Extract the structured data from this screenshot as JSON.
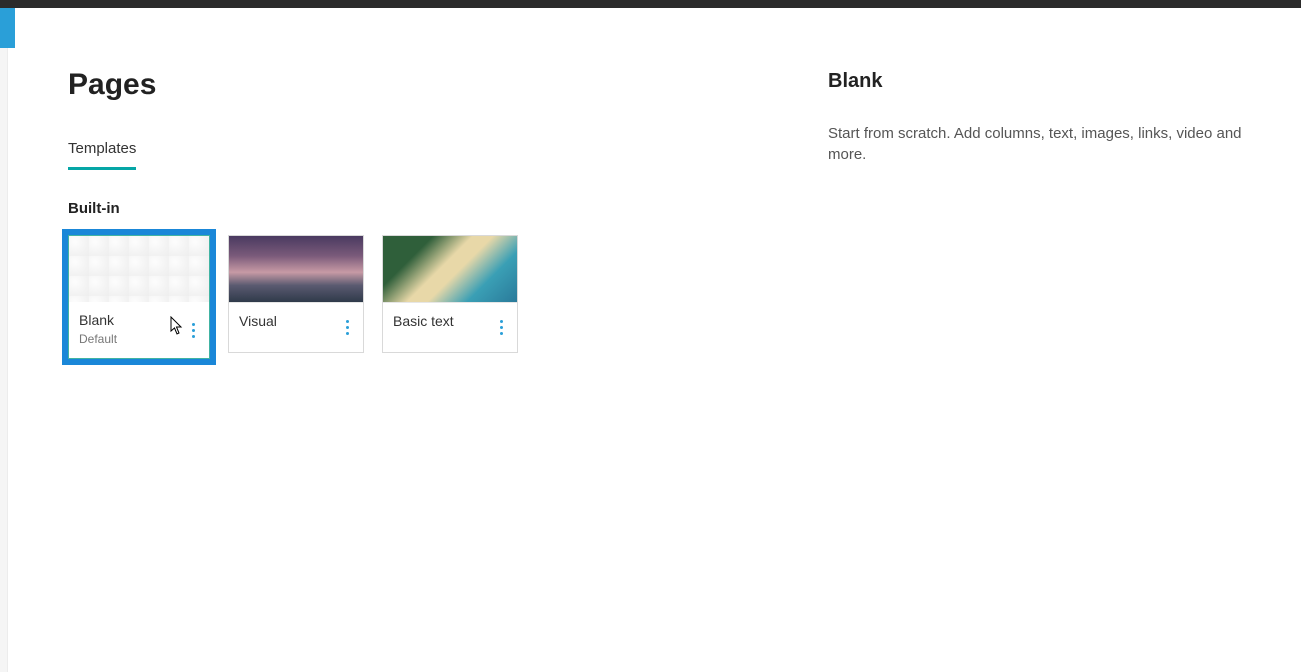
{
  "header": {
    "title": "Pages"
  },
  "tabs": [
    {
      "label": "Templates",
      "active": true
    }
  ],
  "section": {
    "heading": "Built-in"
  },
  "templates": [
    {
      "title": "Blank",
      "sub": "Default",
      "selected": true,
      "thumb": "blank"
    },
    {
      "title": "Visual",
      "sub": "",
      "selected": false,
      "thumb": "visual"
    },
    {
      "title": "Basic text",
      "sub": "",
      "selected": false,
      "thumb": "basic"
    }
  ],
  "detail": {
    "title": "Blank",
    "description": "Start from scratch. Add columns, text, images, links, video and more."
  }
}
